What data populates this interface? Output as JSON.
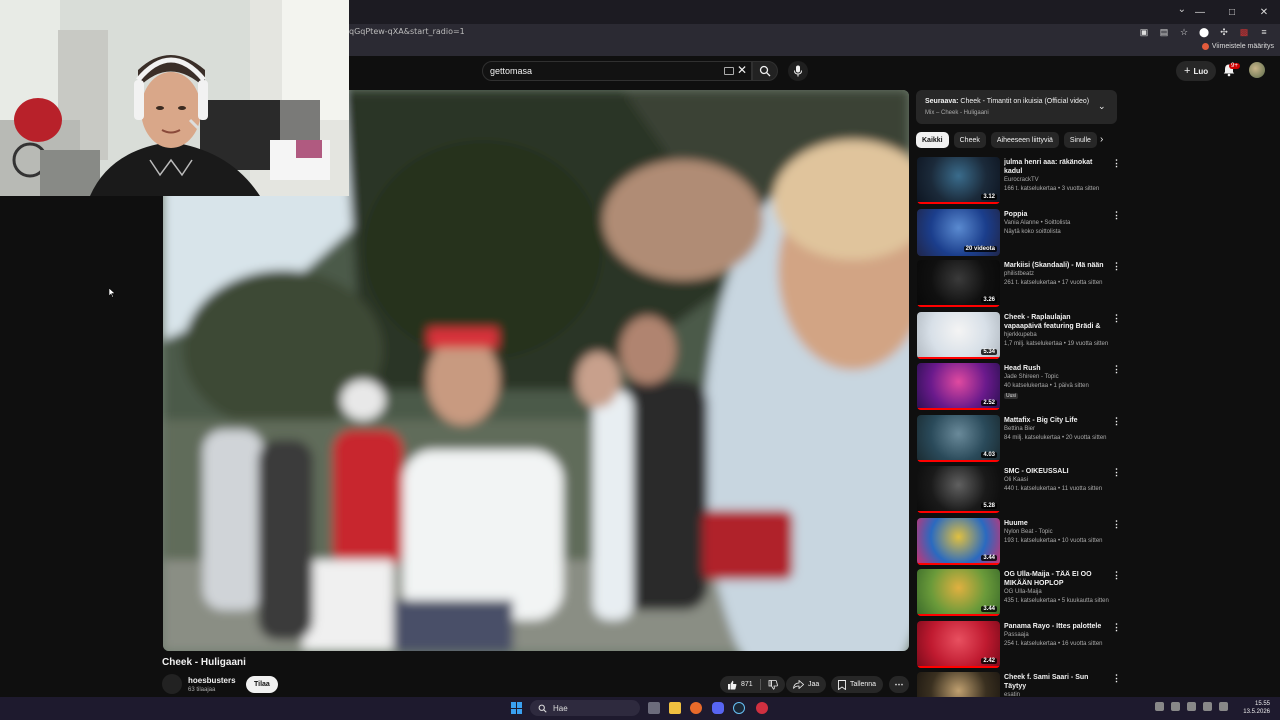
{
  "browser": {
    "url": "qGqPtew-qXA&start_radio=1",
    "bookmark_label": "Viimeistele määritys",
    "window_minimize": "—",
    "window_maximize": "□",
    "window_close": "✕"
  },
  "masthead": {
    "search_query": "gettomasa",
    "create_label": "Luo",
    "notifications_badge": "9+"
  },
  "video": {
    "title": "Cheek - Huligaani",
    "channel": "hoesbusters",
    "subscribers": "63 tilaajaa",
    "subscribe_label": "Tilaa",
    "likes": "871",
    "share_label": "Jaa",
    "save_label": "Tallenna"
  },
  "up_next": {
    "prefix": "Seuraava:",
    "title": "Cheek - Timantit on ikuisia (Official video)",
    "subtitle": "Mix – Cheek - Huligaani"
  },
  "chips": [
    "Kaikki",
    "Cheek",
    "Aiheeseen liittyviä",
    "Sinulle"
  ],
  "recommendations": [
    {
      "title": "julma henri aaa: räkänokat kadul",
      "channel": "EurocrackTV",
      "meta": "166 t. katselukertaa • 3 vuotta sitten",
      "duration": "3.12",
      "colors": [
        "#1b2a3a",
        "#3a6c8c",
        "#0d1420"
      ]
    },
    {
      "title": "Poppia",
      "channel": "Vania Alanne • Soittolista",
      "meta": "Näytä koko soittolista",
      "duration": "20 videota",
      "colors": [
        "#1b3e8c",
        "#5a8ad0",
        "#20264a"
      ]
    },
    {
      "title": "Markiisi (Skandaali) - Mä nään",
      "channel": "philistbeatz",
      "meta": "261 t. katselukertaa • 17 vuotta sitten",
      "duration": "3.26",
      "colors": [
        "#101010",
        "#3a3a3a",
        "#080808"
      ]
    },
    {
      "title": "Cheek - Raplaulajan vapaapäivä featuring Brädi & Pappa",
      "channel": "hjerkkupeba",
      "meta": "1,7 milj. katselukertaa • 19 vuotta sitten",
      "duration": "5.34",
      "colors": [
        "#d8e0e8",
        "#f4f4f4",
        "#b0b8c0"
      ]
    },
    {
      "title": "Head Rush",
      "channel": "Jade Shireen - Topic",
      "meta": "40 katselukertaa • 1 päivä sitten",
      "badge": "Uusi",
      "duration": "2.52",
      "colors": [
        "#6a1a8c",
        "#e04aa0",
        "#2a1050"
      ]
    },
    {
      "title": "Mattafix - Big City Life",
      "channel": "Bettina Bier",
      "meta": "84 milj. katselukertaa • 20 vuotta sitten",
      "duration": "4.03",
      "colors": [
        "#2a4a5a",
        "#6a8a9a",
        "#1a2a30"
      ]
    },
    {
      "title": "SMC - OIKEUSSALI",
      "channel": "Oli Kaasi",
      "meta": "440 t. katselukertaa • 11 vuotta sitten",
      "duration": "5.28",
      "colors": [
        "#1a1a1a",
        "#606060",
        "#0a0a0a"
      ]
    },
    {
      "title": "Huume",
      "channel": "Nylon Beat - Topic",
      "meta": "193 t. katselukertaa • 10 vuotta sitten",
      "duration": "3.44",
      "colors": [
        "#2a6ac0",
        "#e0c040",
        "#d03070"
      ]
    },
    {
      "title": "OG Ulla-Maija - TÄÄ EI OO MIKÄÄN HOPLOP",
      "channel": "OG Ulla-Maija",
      "meta": "435 t. katselukertaa • 5 kuukautta sitten",
      "duration": "3.44",
      "colors": [
        "#6a9a3a",
        "#e0b040",
        "#3a6a2a"
      ]
    },
    {
      "title": "Panama Rayo - Ittes palottele",
      "channel": "Passaaja",
      "meta": "254 t. katselukertaa • 16 vuotta sitten",
      "duration": "2.42",
      "colors": [
        "#c01a30",
        "#e85060",
        "#7a0a1a"
      ]
    },
    {
      "title": "Cheek f. Sami Saari - Sun Täytyy",
      "channel": "esatin",
      "meta": "",
      "duration": "",
      "colors": [
        "#3a3020",
        "#c0a070",
        "#1a1510"
      ]
    }
  ],
  "taskbar": {
    "search_label": "Hae",
    "time": "15.55",
    "date": "13.5.2026"
  }
}
